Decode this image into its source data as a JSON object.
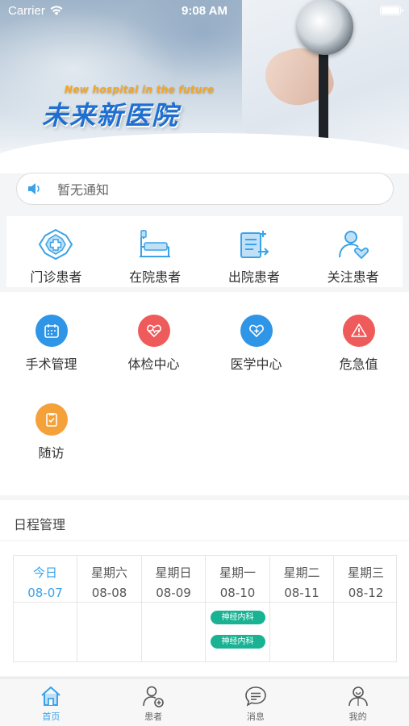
{
  "status_bar": {
    "carrier": "Carrier",
    "time": "9:08 AM"
  },
  "banner": {
    "slogan_en": "New hospital in the future",
    "slogan_cn": "未来新医院"
  },
  "notice": {
    "text": "暂无通知",
    "icon": "speaker-icon"
  },
  "patient_types": [
    {
      "label": "门诊患者",
      "icon": "outpatient-icon"
    },
    {
      "label": "在院患者",
      "icon": "inpatient-bed-icon"
    },
    {
      "label": "出院患者",
      "icon": "discharge-icon"
    },
    {
      "label": "关注患者",
      "icon": "followed-patient-icon"
    }
  ],
  "functions": [
    {
      "label": "手术管理",
      "icon": "calendar-icon",
      "color": "#2f95e6"
    },
    {
      "label": "体检中心",
      "icon": "heartbeat-icon",
      "color": "#ef5a5a"
    },
    {
      "label": "医学中心",
      "icon": "medical-heart-icon",
      "color": "#2f95e6"
    },
    {
      "label": "危急值",
      "icon": "warning-icon",
      "color": "#ef5a5a"
    },
    {
      "label": "随访",
      "icon": "checklist-icon",
      "color": "#f5a13a"
    }
  ],
  "schedule": {
    "title": "日程管理",
    "days": [
      {
        "day": "今日",
        "date": "08-07",
        "events": []
      },
      {
        "day": "星期六",
        "date": "08-08",
        "events": []
      },
      {
        "day": "星期日",
        "date": "08-09",
        "events": []
      },
      {
        "day": "星期一",
        "date": "08-10",
        "events": [
          "神经内科",
          "神经内科"
        ]
      },
      {
        "day": "星期二",
        "date": "08-11",
        "events": []
      },
      {
        "day": "星期三",
        "date": "08-12",
        "events": []
      }
    ],
    "event_color": "#19b394"
  },
  "tabs": [
    {
      "label": "首页",
      "icon": "home-icon",
      "active": true
    },
    {
      "label": "患者",
      "icon": "patient-icon",
      "active": false
    },
    {
      "label": "消息",
      "icon": "message-icon",
      "active": false
    },
    {
      "label": "我的",
      "icon": "profile-icon",
      "active": false
    }
  ],
  "colors": {
    "accent": "#3aa2e8",
    "slogan": "#1f6fd1"
  }
}
